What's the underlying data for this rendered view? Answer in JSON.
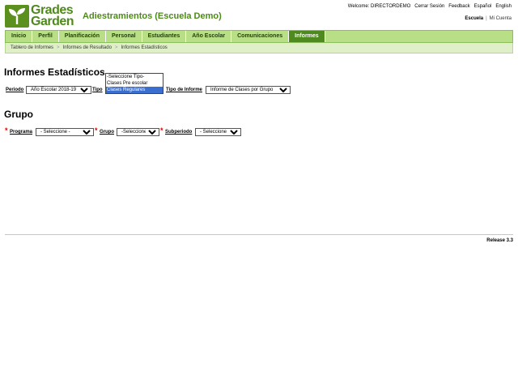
{
  "logo": {
    "line1": "Grades",
    "line2": "Garden"
  },
  "header": {
    "school_title": "Adiestramientos (Escuela Demo)",
    "welcome": "Welcome: DIRECTORDEMO",
    "logout": "Cerrar Sesión",
    "feedback": "Feedback",
    "lang_es": "Español",
    "lang_en": "English",
    "role_selected": "Escuela",
    "role_separator": "|",
    "role_other": "Mi Cuenta"
  },
  "nav": {
    "tabs": [
      "Inicio",
      "Perfil",
      "Planificación",
      "Personal",
      "Estudiantes",
      "Año Escolar",
      "Comunicaciones",
      "Informes"
    ],
    "active": "Informes"
  },
  "breadcrumb": [
    "Tablero de Informes",
    "Informes de Resultado",
    "Informes Estadísticos"
  ],
  "section1": {
    "title": "Informes Estadísticos",
    "periodo_label": "Periodo",
    "periodo_value": "Año Escolar 2018-19",
    "tipo_label": "Tipo",
    "tipo_options": [
      "-Seleccione Tipo-",
      "Clases Pre escolar",
      "Clases Regulares"
    ],
    "tipo_selected": "Clases Regulares",
    "tipo_informe_label": "Tipo de Informe",
    "tipo_informe_value": "Informe de Clases por Grupo"
  },
  "section2": {
    "title": "Grupo",
    "required_mark": "*",
    "programa_label": "Programa",
    "programa_value": "- Seleccione -",
    "grupo_label": "Grupo",
    "grupo_value": "-Seleccione-",
    "subperiodo_label": "Subperiodo",
    "subperiodo_value": "- Seleccione -"
  },
  "footer": {
    "release": "Release 3.3"
  },
  "colors": {
    "brand_green": "#4e8a1a",
    "nav_bg": "#b9df86",
    "nav_active": "#4f8a1e",
    "required": "#dd0000"
  }
}
